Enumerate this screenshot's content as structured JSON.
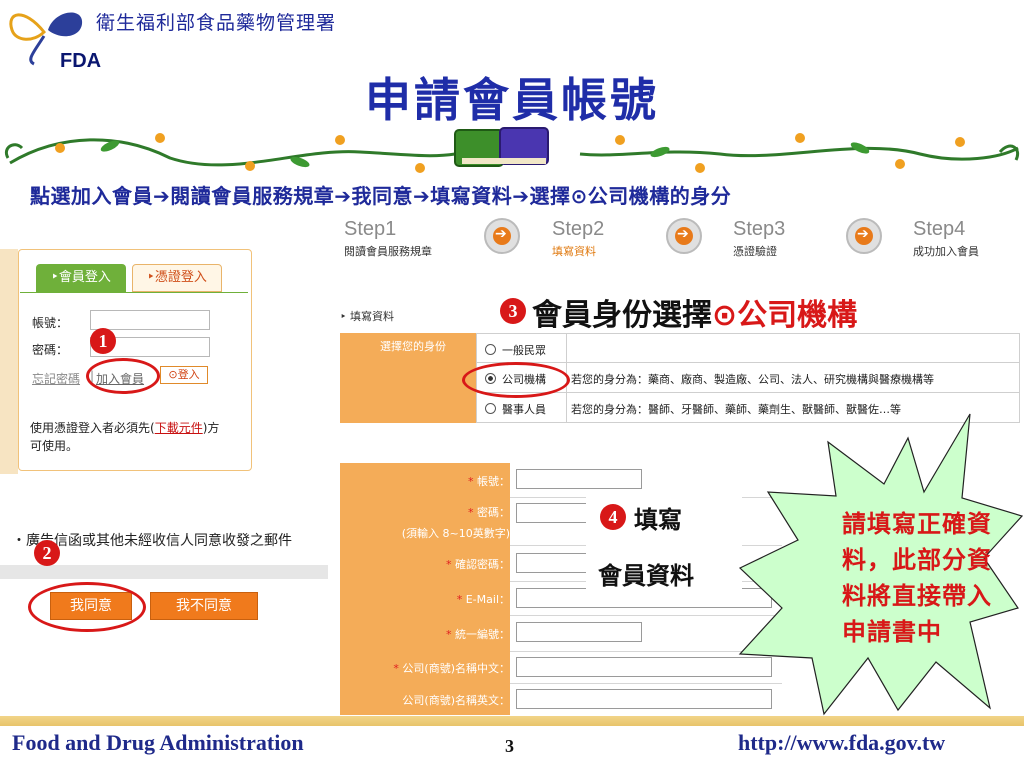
{
  "header": {
    "org_name": "衛生福利部食品藥物管理署",
    "logo_text": "FDA",
    "title": "申請會員帳號"
  },
  "instruction": "點選加入會員➔閱讀會員服務規章➔我同意➔填寫資料➔選擇⊙公司機構的身分",
  "steps": [
    {
      "label": "Step1",
      "sub": "閱讀會員服務規章"
    },
    {
      "label": "Step2",
      "sub": "填寫資料"
    },
    {
      "label": "Step3",
      "sub": "憑證驗證"
    },
    {
      "label": "Step4",
      "sub": "成功加入會員"
    }
  ],
  "login": {
    "tab_member": "‣會員登入",
    "tab_cert": "‣憑證登入",
    "account_label": "帳號：",
    "password_label": "密碼：",
    "forgot": "忘記密碼",
    "join": "加入會員",
    "login_btn": "⊙登入",
    "note_prefix": "使用憑證登入者必須先(",
    "note_link": "下載元件",
    "note_suffix": ")方可使用。"
  },
  "badges": {
    "one": "1",
    "two": "2",
    "three": "3",
    "four": "4"
  },
  "terms": {
    "text": "・廣告信函或其他未經收信人同意收發之郵件",
    "agree": "我同意",
    "disagree": "我不同意"
  },
  "identity": {
    "section": "‣ 填寫資料",
    "title_main": "會員身份選擇",
    "title_red": "⊙公司機構",
    "label": "選擇您的身份",
    "options": [
      {
        "name": "一般民眾",
        "desc": ""
      },
      {
        "name": "公司機構",
        "desc": "若您的身分為：藥商、廠商、製造廠、公司、法人、研究機構與醫療機構等"
      },
      {
        "name": "醫事人員",
        "desc": "若您的身分為：醫師、牙醫師、藥師、藥劑生、獸醫師、獸醫佐…等"
      }
    ]
  },
  "form": {
    "star": "*",
    "fields": [
      {
        "label": "帳號：",
        "required": true
      },
      {
        "label": "密碼：",
        "required": true,
        "hint": "(須輸入 8~10英數字)"
      },
      {
        "label": "確認密碼：",
        "required": true
      },
      {
        "label": "E-Mail：",
        "required": true
      },
      {
        "label": "統一編號：",
        "required": true
      },
      {
        "label": "公司(商號)名稱中文：",
        "required": true
      },
      {
        "label": "公司(商號)名稱英文：",
        "required": false
      }
    ],
    "step4_line1": "填寫",
    "step4_line2": "會員資料"
  },
  "callout": "請填寫正確資料，此部分資料將直接帶入申請書中",
  "footer": {
    "left": "Food and Drug Administration",
    "page": "3",
    "right": "http://www.fda.gov.tw"
  },
  "colors": {
    "title_blue": "#1f2da8",
    "accent_orange": "#f07a1c",
    "highlight_red": "#d81818",
    "callout_fill": "#ccffcc"
  }
}
